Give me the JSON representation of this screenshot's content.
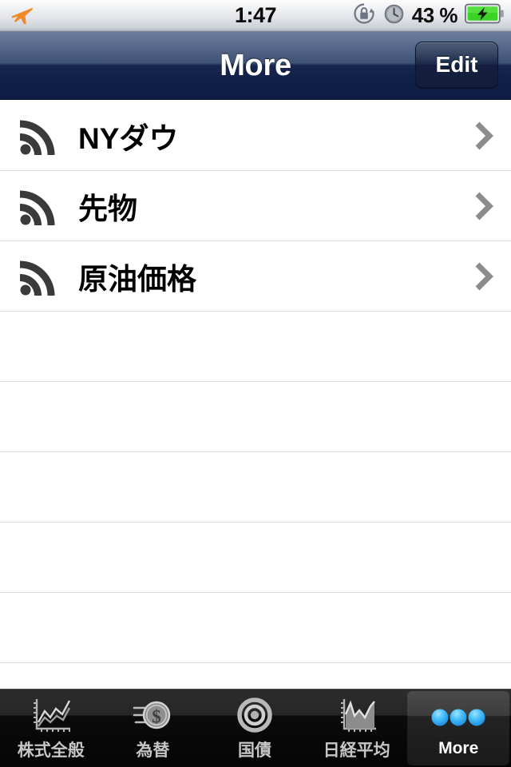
{
  "status_bar": {
    "airplane_icon": "airplane-icon",
    "time": "1:47",
    "rotation_lock_icon": "rotation-lock-icon",
    "alarm_icon": "alarm-clock-icon",
    "battery_percent": "43 %",
    "battery_icon": "battery-charging-icon",
    "battery_color": "#3ad225"
  },
  "nav_bar": {
    "title": "More",
    "edit_label": "Edit",
    "background_color": "#16264d"
  },
  "list": {
    "rows": [
      {
        "icon": "rss-feed-icon",
        "label": "NYダウ",
        "accessory": "chevron-right-icon"
      },
      {
        "icon": "rss-feed-icon",
        "label": "先物",
        "accessory": "chevron-right-icon"
      },
      {
        "icon": "rss-feed-icon",
        "label": "原油価格",
        "accessory": "chevron-right-icon"
      }
    ],
    "empty_row_count": 5,
    "separator_color": "#dcdcdc",
    "icon_color": "#3a3a3a",
    "chevron_color": "#8c8c8c"
  },
  "tab_bar": {
    "items": [
      {
        "label": "株式全般",
        "icon": "line-chart-icon",
        "selected": false
      },
      {
        "label": "為替",
        "icon": "dollar-coin-icon",
        "selected": false
      },
      {
        "label": "国債",
        "icon": "target-bullseye-icon",
        "selected": false
      },
      {
        "label": "日経平均",
        "icon": "area-chart-icon",
        "selected": false
      },
      {
        "label": "More",
        "icon": "three-dots-icon",
        "selected": true
      }
    ],
    "selected_index": 4,
    "dot_color": "#38b6f0"
  }
}
